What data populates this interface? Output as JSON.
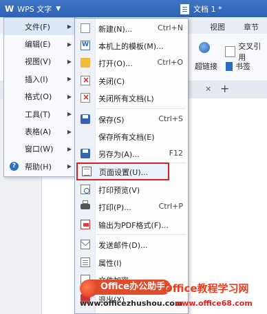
{
  "app": {
    "button_label": "WPS 文字",
    "logo": "W",
    "arrow": "▼"
  },
  "document": {
    "title": "文档 1 *"
  },
  "ribbon": {
    "tabs": [
      "视图",
      "章节"
    ],
    "buttons": {
      "hyperlink": "超链接",
      "bookmark": "书签",
      "cross_ref": "交叉引用"
    },
    "new_tab": "+",
    "close_tab": "✕"
  },
  "main_menu": {
    "items": [
      {
        "label": "文件(F)",
        "has_sub": true
      },
      {
        "label": "编辑(E)",
        "has_sub": true
      },
      {
        "label": "视图(V)",
        "has_sub": true
      },
      {
        "label": "插入(I)",
        "has_sub": true
      },
      {
        "label": "格式(O)",
        "has_sub": true
      },
      {
        "label": "工具(T)",
        "has_sub": true
      },
      {
        "label": "表格(A)",
        "has_sub": true
      },
      {
        "label": "窗口(W)",
        "has_sub": true
      },
      {
        "label": "帮助(H)",
        "has_sub": true
      }
    ],
    "sub_arrow": "▶",
    "help_icon": "?"
  },
  "file_menu": {
    "items": [
      {
        "label": "新建(N)...",
        "shortcut": "Ctrl+N",
        "icon": "new-doc-icon"
      },
      {
        "label": "本机上的模板(M)...",
        "shortcut": "",
        "icon": "template-icon"
      },
      {
        "label": "打开(O)...",
        "shortcut": "Ctrl+O",
        "icon": "folder-icon"
      },
      {
        "label": "关闭(C)",
        "shortcut": "",
        "icon": "close-doc-icon"
      },
      {
        "label": "关闭所有文档(L)",
        "shortcut": "",
        "icon": "close-all-icon"
      },
      {
        "label": "保存(S)",
        "shortcut": "Ctrl+S",
        "icon": "save-icon"
      },
      {
        "label": "保存所有文档(E)",
        "shortcut": "",
        "icon": ""
      },
      {
        "label": "另存为(A)...",
        "shortcut": "F12",
        "icon": "save-as-icon"
      },
      {
        "label": "页面设置(U)...",
        "shortcut": "",
        "icon": "page-setup-icon",
        "highlighted": true
      },
      {
        "label": "打印预览(V)",
        "shortcut": "",
        "icon": "print-preview-icon"
      },
      {
        "label": "打印(P)...",
        "shortcut": "Ctrl+P",
        "icon": "print-icon"
      },
      {
        "label": "输出为PDF格式(F)...",
        "shortcut": "",
        "icon": "pdf-icon"
      },
      {
        "label": "发送邮件(D)...",
        "shortcut": "",
        "icon": "mail-icon"
      },
      {
        "label": "属性(I)",
        "shortcut": "",
        "icon": "properties-icon"
      },
      {
        "label": "文件加密",
        "shortcut": "",
        "icon": "encrypt-icon"
      },
      {
        "label": "退出(X)",
        "shortcut": "",
        "icon": "exit-icon"
      }
    ]
  },
  "watermark": {
    "brand": "Office办公助手",
    "title": "Office教程学习网",
    "url1": "www.officezhushou.com",
    "url2": "www.office68.com"
  },
  "colors": {
    "highlight_border": "#d42020",
    "titlebar": "#2f62b3",
    "accent": "#e04b2a"
  }
}
